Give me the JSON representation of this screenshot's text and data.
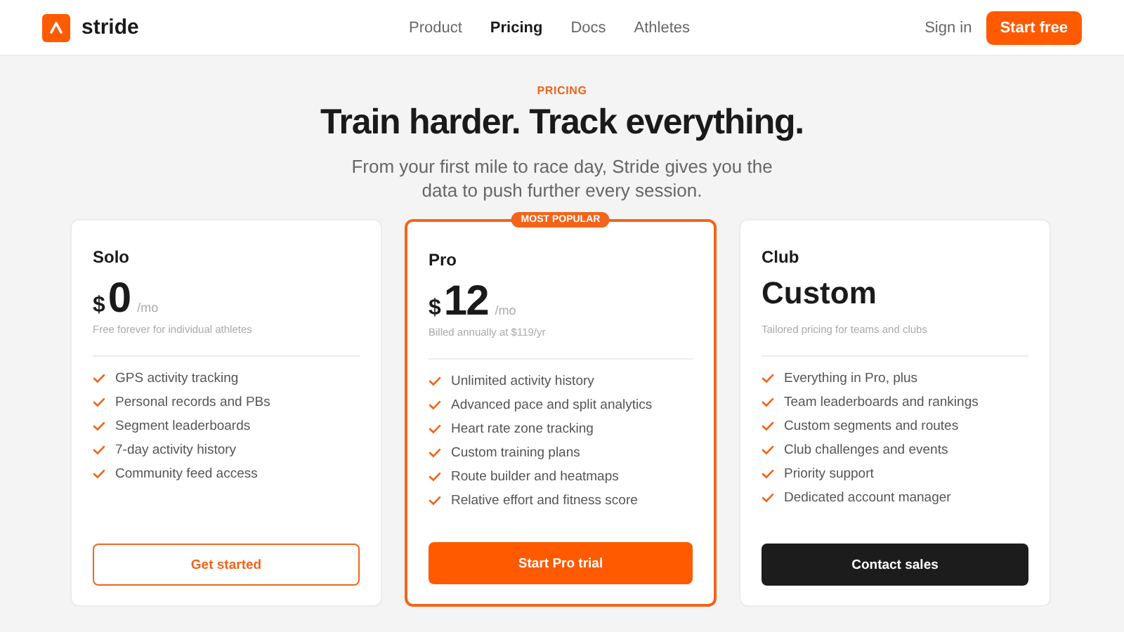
{
  "brand": {
    "name": "stride"
  },
  "nav": [
    {
      "label": "Product",
      "selected": false
    },
    {
      "label": "Pricing",
      "selected": true
    },
    {
      "label": "Docs",
      "selected": false
    },
    {
      "label": "Athletes",
      "selected": false
    }
  ],
  "sign_in": "Sign in",
  "cta": "Start free",
  "hero": {
    "eyebrow": "PRICING",
    "title": "Train harder. Track everything.",
    "subtitle": "From your first mile to race day, Stride gives you the data to push further every session."
  },
  "plans": [
    {
      "name": "Solo",
      "kind": "amount",
      "currency": "$",
      "price": "0",
      "period": "/mo",
      "note": "Free forever for individual athletes",
      "featured": false,
      "features": [
        "GPS activity tracking",
        "Personal records and PBs",
        "Segment leaderboards",
        "7-day activity history",
        "Community feed access"
      ],
      "button": {
        "label": "Get started",
        "kind": "outline"
      }
    },
    {
      "name": "Pro",
      "kind": "amount",
      "currency": "$",
      "price": "12",
      "period": "/mo",
      "note": "Billed annually at $119/yr",
      "featured": true,
      "badge": "MOST POPULAR",
      "features": [
        "Unlimited activity history",
        "Advanced pace and split analytics",
        "Heart rate zone tracking",
        "Custom training plans",
        "Route builder and heatmaps",
        "Relative effort and fitness score"
      ],
      "button": {
        "label": "Start Pro trial",
        "kind": "primary"
      }
    },
    {
      "name": "Club",
      "kind": "custom",
      "price": "Custom",
      "note": "Tailored pricing for teams and clubs",
      "featured": false,
      "features": [
        "Everything in Pro, plus",
        "Team leaderboards and rankings",
        "Custom segments and routes",
        "Club challenges and events",
        "Priority support",
        "Dedicated account manager"
      ],
      "button": {
        "label": "Contact sales",
        "kind": "dark"
      }
    }
  ]
}
